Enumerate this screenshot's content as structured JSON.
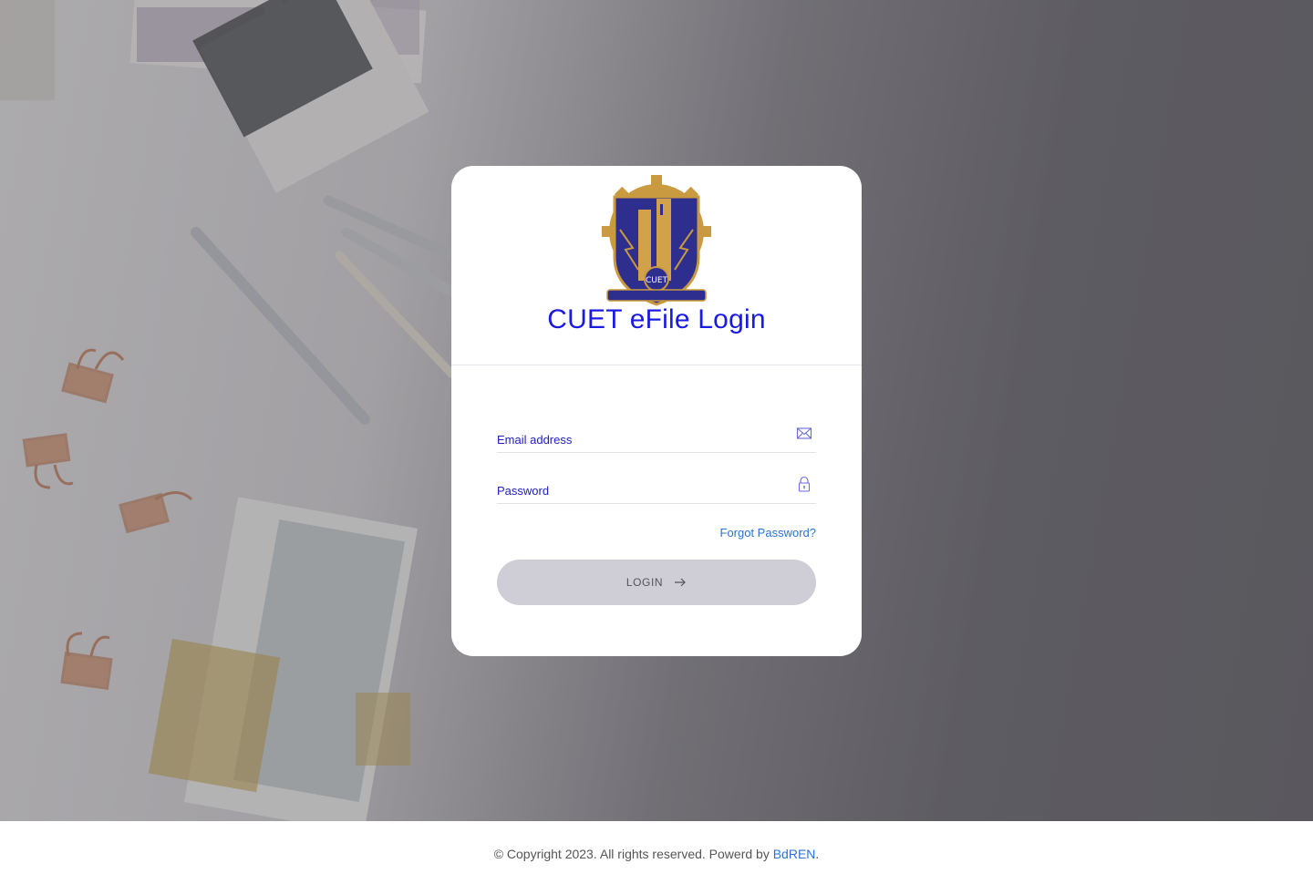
{
  "login": {
    "title": "CUET eFile Login",
    "logo_text": "CUET",
    "email_placeholder": "Email address",
    "password_placeholder": "Password",
    "forgot_label": "Forgot Password?",
    "login_label": "LOGIN"
  },
  "footer": {
    "copyright": "© Copyright 2023. All rights reserved. Powerd by ",
    "brand": "BdREN",
    "trail": "."
  },
  "icons": {
    "email": "envelope-icon",
    "password": "lock-icon",
    "login": "arrow-right-icon"
  },
  "colors": {
    "title": "#1a1ae0",
    "link": "#2b74d6",
    "button_bg": "#cfcdd6"
  }
}
